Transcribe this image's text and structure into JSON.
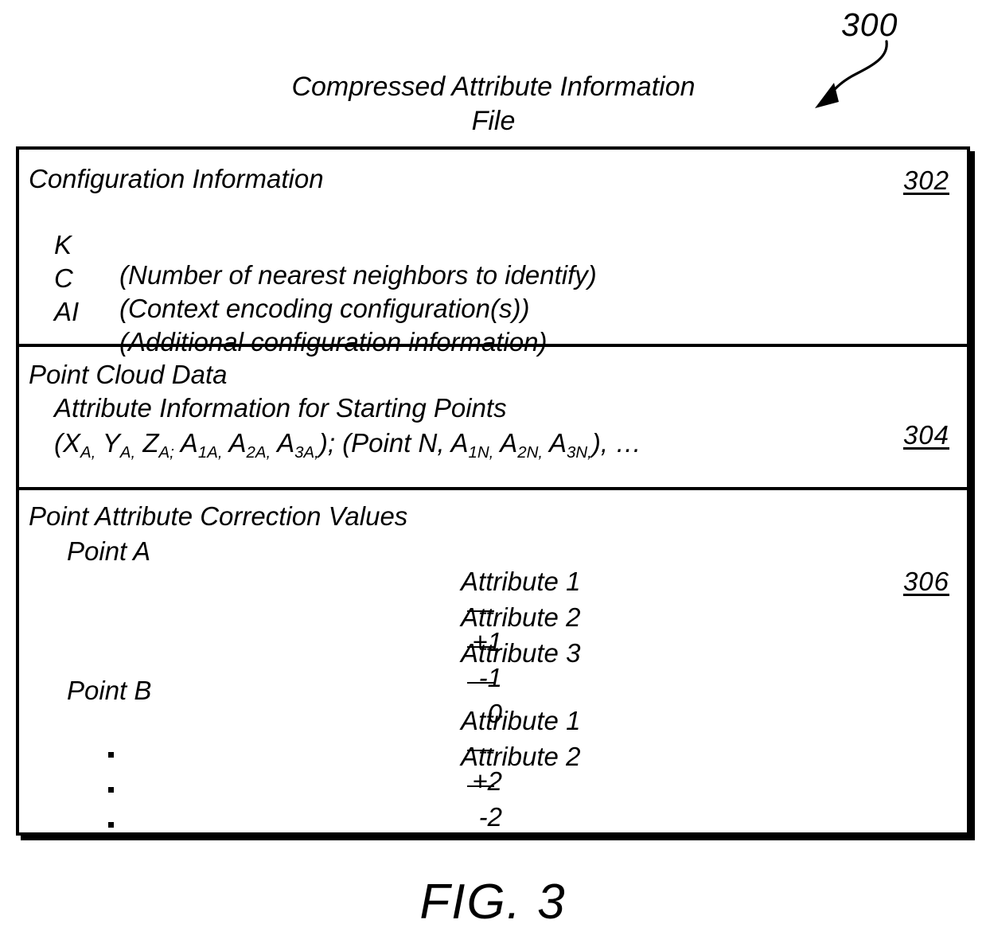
{
  "figure": {
    "reference_number": "300",
    "caption": "FIG. 3",
    "title": "Compressed Attribute Information\nFile"
  },
  "sections": {
    "configuration": {
      "ref": "302",
      "heading": "Configuration Information",
      "rows": [
        {
          "key": "K",
          "desc": "(Number of nearest neighbors to identify)"
        },
        {
          "key": "C",
          "desc": "(Context encoding configuration(s))"
        },
        {
          "key": "AI",
          "desc": "(Additional configuration information)"
        }
      ]
    },
    "point_cloud_data": {
      "ref": "304",
      "heading": "Point Cloud Data",
      "subheading": "Attribute Information for Starting Points",
      "expression": "(XA, YA, ZA; A1A, A2A, A3A,); (Point N, A1N, A2N, A3N,), …"
    },
    "correction_values": {
      "ref": "306",
      "heading": "Point Attribute Correction Values",
      "points": [
        {
          "label": "Point A",
          "attributes": [
            {
              "name": "Attribute 1",
              "value": "+1"
            },
            {
              "name": "Attribute 2",
              "value": "-1"
            },
            {
              "name": "Attribute 3",
              "value": "0"
            }
          ]
        },
        {
          "label": "Point B",
          "attributes": [
            {
              "name": "Attribute 1",
              "value": "+2"
            },
            {
              "name": "Attribute 2",
              "value": "-2"
            }
          ]
        }
      ],
      "continuation": "vertical-ellipsis"
    }
  }
}
